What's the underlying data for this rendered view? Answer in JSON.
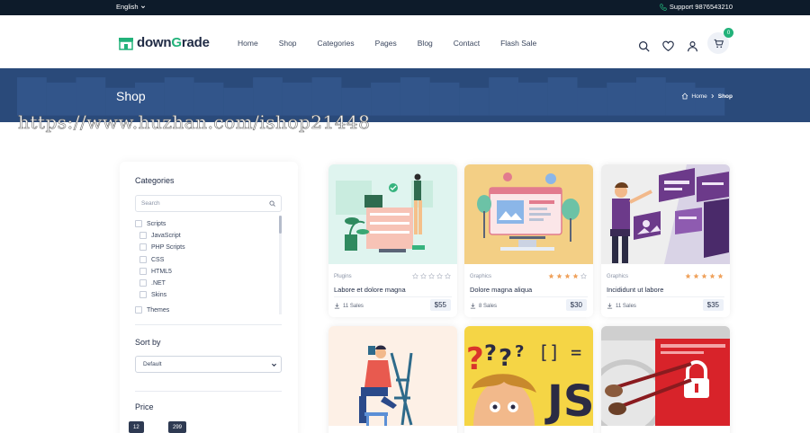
{
  "topbar": {
    "language": "English",
    "support": "Support 9876543210"
  },
  "header": {
    "logo_prefix": "down",
    "logo_accent": "G",
    "logo_suffix": "rade",
    "nav": [
      "Home",
      "Shop",
      "Categories",
      "Pages",
      "Blog",
      "Contact",
      "Flash Sale"
    ],
    "cart_count": "0"
  },
  "banner": {
    "title": "Shop",
    "breadcrumb_home": "Home",
    "breadcrumb_current": "Shop"
  },
  "watermark": "https://www.huzhan.com/ishop21448",
  "sidebar": {
    "categories_heading": "Categories",
    "search_placeholder": "Search",
    "categories": [
      "Scripts",
      "JavaScript",
      "PHP Scripts",
      "CSS",
      "HTML5",
      ".NET",
      "Skins",
      "Themes"
    ],
    "sort_heading": "Sort by",
    "sort_value": "Default",
    "price_heading": "Price",
    "price_min": "12",
    "price_max": "299"
  },
  "products": [
    {
      "category": "Plugins",
      "title": "Labore et dolore magna",
      "sales": "11 Sales",
      "price": "$55",
      "rating": 0
    },
    {
      "category": "Graphics",
      "title": "Dolore magna aliqua",
      "sales": "8 Sales",
      "price": "$30",
      "rating": 4
    },
    {
      "category": "Graphics",
      "title": "Incididunt ut labore",
      "sales": "11 Sales",
      "price": "$35",
      "rating": 5
    }
  ],
  "colors": {
    "accent": "#22b27a",
    "banner": "#2a4a7a",
    "topbar": "#0d1b2a",
    "star": "#f0a35e"
  }
}
